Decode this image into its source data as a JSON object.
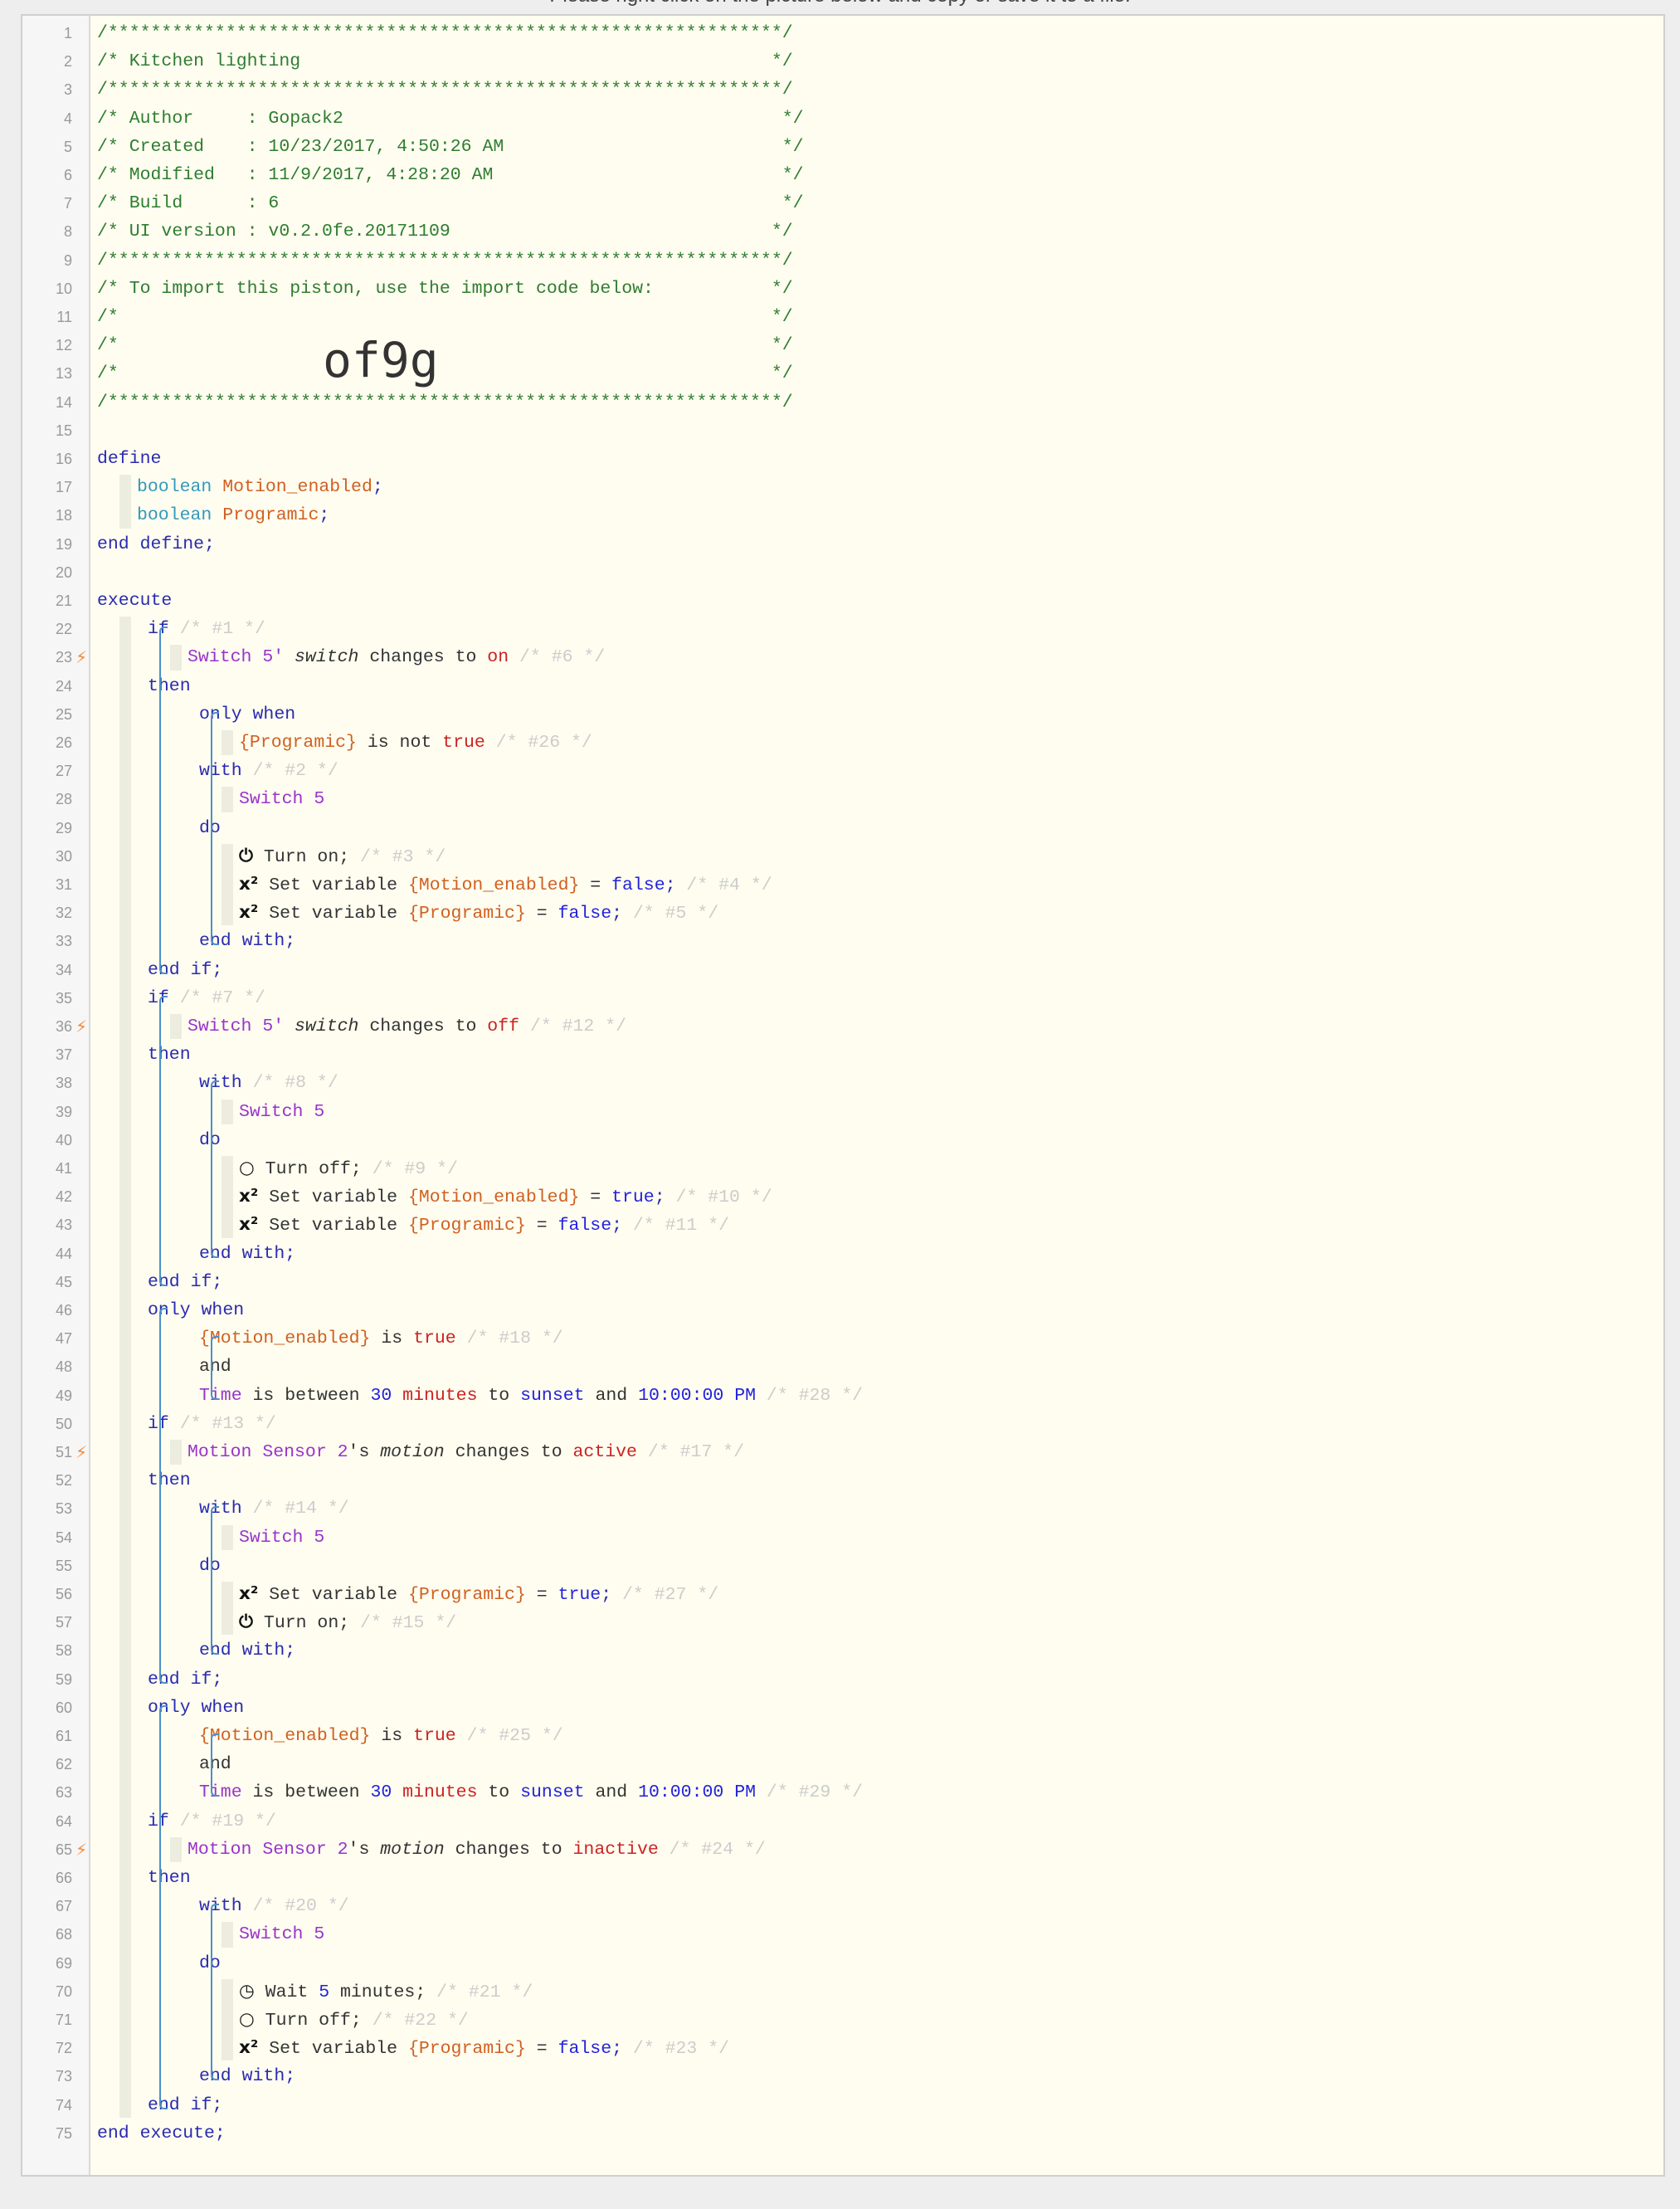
{
  "caption": "Please right click on the picture below and copy or save it to a file.",
  "header": {
    "stars": "/***************************************************************/",
    "title": "/* Kitchen lighting                                            */",
    "author": "/* Author     : Gopack2                                         */",
    "created": "/* Created    : 10/23/2017, 4:50:26 AM                          */",
    "modified": "/* Modified   : 11/9/2017, 4:28:20 AM                           */",
    "build": "/* Build      : 6                                               */",
    "ui_version": "/* UI version : v0.2.0fe.20171109                              */",
    "import_note": "/* To import this piston, use the import code below:           */",
    "blank": "/*                                                             */",
    "import_code": "of9g"
  },
  "code": {
    "define": "define",
    "boolean": "boolean",
    "var_motion_enabled": "Motion_enabled",
    "var_programic": "Programic",
    "end_define": "end define;",
    "execute": "execute",
    "if": "if",
    "then": "then",
    "only_when": "only when",
    "with": "with",
    "do": "do",
    "end_with": "end with;",
    "end_if": "end if;",
    "and": "and",
    "end_execute": "end execute;",
    "semicolon": ";",
    "switch5": "Switch 5",
    "switch5_poss": "Switch 5'",
    "switch_attr": "switch",
    "changes_to": "changes to",
    "on": "on",
    "off": "off",
    "programic_ref": "{Programic}",
    "motion_enabled_ref": "{Motion_enabled}",
    "is_not": "is not",
    "is": "is",
    "true": "true",
    "false": "false",
    "turn_on": "Turn on;",
    "turn_off": "Turn off;",
    "set_variable": "Set variable",
    "eq": "=",
    "time": "Time",
    "is_between": "is between",
    "thirty": "30",
    "minutes": "minutes",
    "to": "to",
    "sunset": "sunset",
    "ten_pm": "10:00:00 PM",
    "motion_sensor": "Motion Sensor 2",
    "poss_s": "'s",
    "motion_attr": "motion",
    "active": "active",
    "inactive": "inactive",
    "wait": "Wait",
    "five": "5",
    "minutes_semi": "minutes;",
    "power_on_icon": "⏻",
    "power_off_icon": "○",
    "timer_icon": "◷",
    "variable_icon": "x²",
    "c1": "/* #1 */",
    "c6": "/* #6 */",
    "c26": "/* #26 */",
    "c2": "/* #2 */",
    "c3": "/* #3 */",
    "c4": "/* #4 */",
    "c5": "/* #5 */",
    "c7": "/* #7 */",
    "c12": "/* #12 */",
    "c8": "/* #8 */",
    "c9": "/* #9 */",
    "c10": "/* #10 */",
    "c11": "/* #11 */",
    "c18": "/* #18 */",
    "c28": "/* #28 */",
    "c13": "/* #13 */",
    "c17": "/* #17 */",
    "c14": "/* #14 */",
    "c27": "/* #27 */",
    "c15": "/* #15 */",
    "c25": "/* #25 */",
    "c29": "/* #29 */",
    "c19": "/* #19 */",
    "c24": "/* #24 */",
    "c20": "/* #20 */",
    "c21": "/* #21 */",
    "c22": "/* #22 */",
    "c23": "/* #23 */"
  },
  "trigger_lines": [
    23,
    36,
    51,
    65
  ],
  "line_count": 75
}
